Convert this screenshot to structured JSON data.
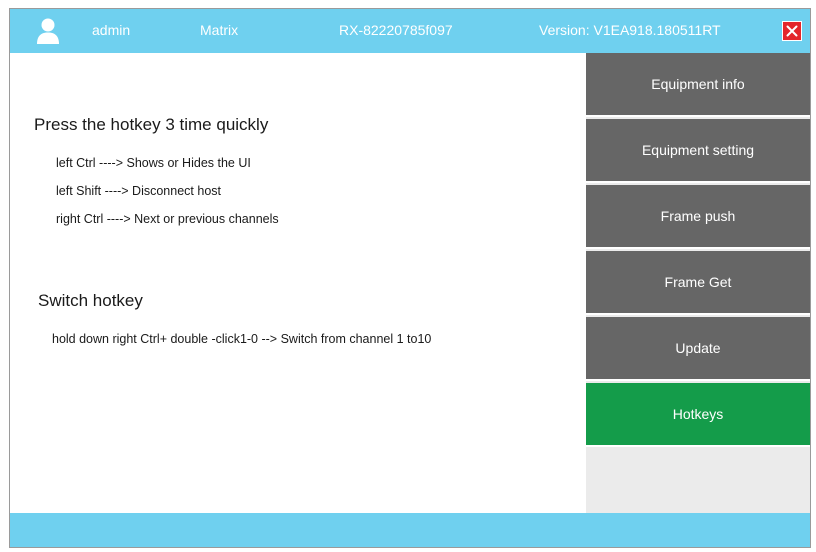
{
  "header": {
    "user_icon": "user-icon",
    "user": "admin",
    "app": "Matrix",
    "serial": "RX-82220785f097",
    "version": "Version: V1EA918.180511RT",
    "close_icon": "close-icon"
  },
  "content": {
    "section1": {
      "title": "Press the hotkey 3 time quickly",
      "lines": [
        "left Ctrl  ----> Shows or Hides the UI",
        "left Shift ----> Disconnect host",
        "right Ctrl  ----> Next or  previous channels"
      ]
    },
    "section2": {
      "title": "Switch hotkey",
      "lines": [
        "hold down right Ctrl+ double -click1-0  --> Switch from  channel 1 to10"
      ]
    }
  },
  "sidebar": {
    "items": [
      {
        "label": "Equipment info",
        "active": false
      },
      {
        "label": "Equipment setting",
        "active": false
      },
      {
        "label": "Frame push",
        "active": false
      },
      {
        "label": "Frame Get",
        "active": false
      },
      {
        "label": "Update",
        "active": false
      },
      {
        "label": "Hotkeys",
        "active": true
      }
    ]
  },
  "colors": {
    "bar": "#6fd0ef",
    "nav": "#666666",
    "nav_active": "#149c4a",
    "close": "#e3262b",
    "sidebar_bg": "#ebebeb"
  }
}
